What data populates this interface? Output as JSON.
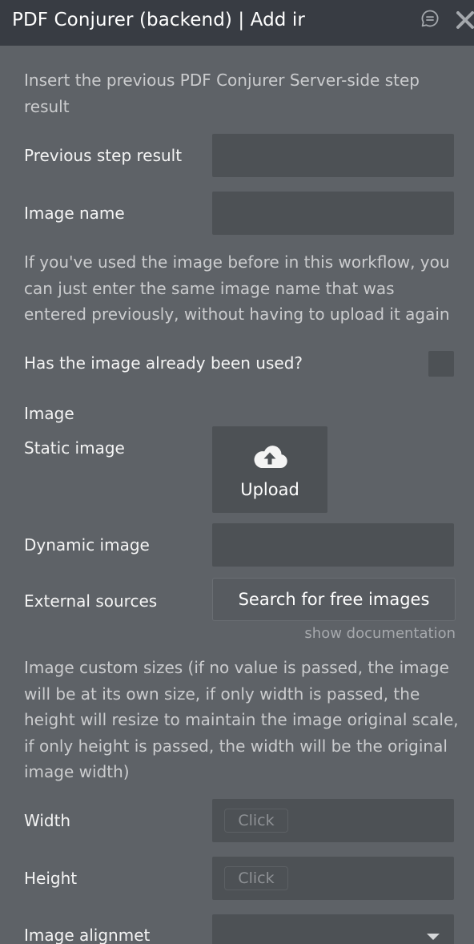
{
  "window": {
    "title": "PDF Conjurer (backend) | Add ir"
  },
  "intro": {
    "text": "Insert the previous PDF Conjurer Server-side step result"
  },
  "fields": {
    "previous_step_result": {
      "label": "Previous step result",
      "value": ""
    },
    "image_name": {
      "label": "Image name",
      "value": ""
    }
  },
  "image_help": {
    "text": "If you've used the image before in this workflow, you can just enter the same image name that was entered previously, without having to upload it again"
  },
  "already_used": {
    "label": "Has the image already been used?",
    "checked": false
  },
  "image": {
    "section_label": "Image",
    "static_label": "Static image",
    "upload_label": "Upload",
    "dynamic_label": "Dynamic image",
    "dynamic_value": "",
    "external_label": "External sources",
    "search_button_label": "Search for free images",
    "show_documentation": "show documentation"
  },
  "custom_sizes": {
    "text": "Image custom sizes (if no value is passed, the image will be at its own size, if only width is passed, the height will resize to maintain the image original scale, if only height is passed, the width will be the original image width)"
  },
  "size_fields": {
    "width": {
      "label": "Width",
      "placeholder": "Click"
    },
    "height": {
      "label": "Height",
      "placeholder": "Click"
    }
  },
  "alignment": {
    "label": "Image alignmet",
    "value": ""
  },
  "icons": {
    "chat": "chat-bubble-icon",
    "close": "close-icon",
    "upload": "cloud-upload-icon",
    "dropdown": "chevron-down-icon"
  },
  "colors": {
    "panel_bg": "#5e6267",
    "titlebar_bg": "#383c43",
    "field_bg": "#4d5155"
  }
}
